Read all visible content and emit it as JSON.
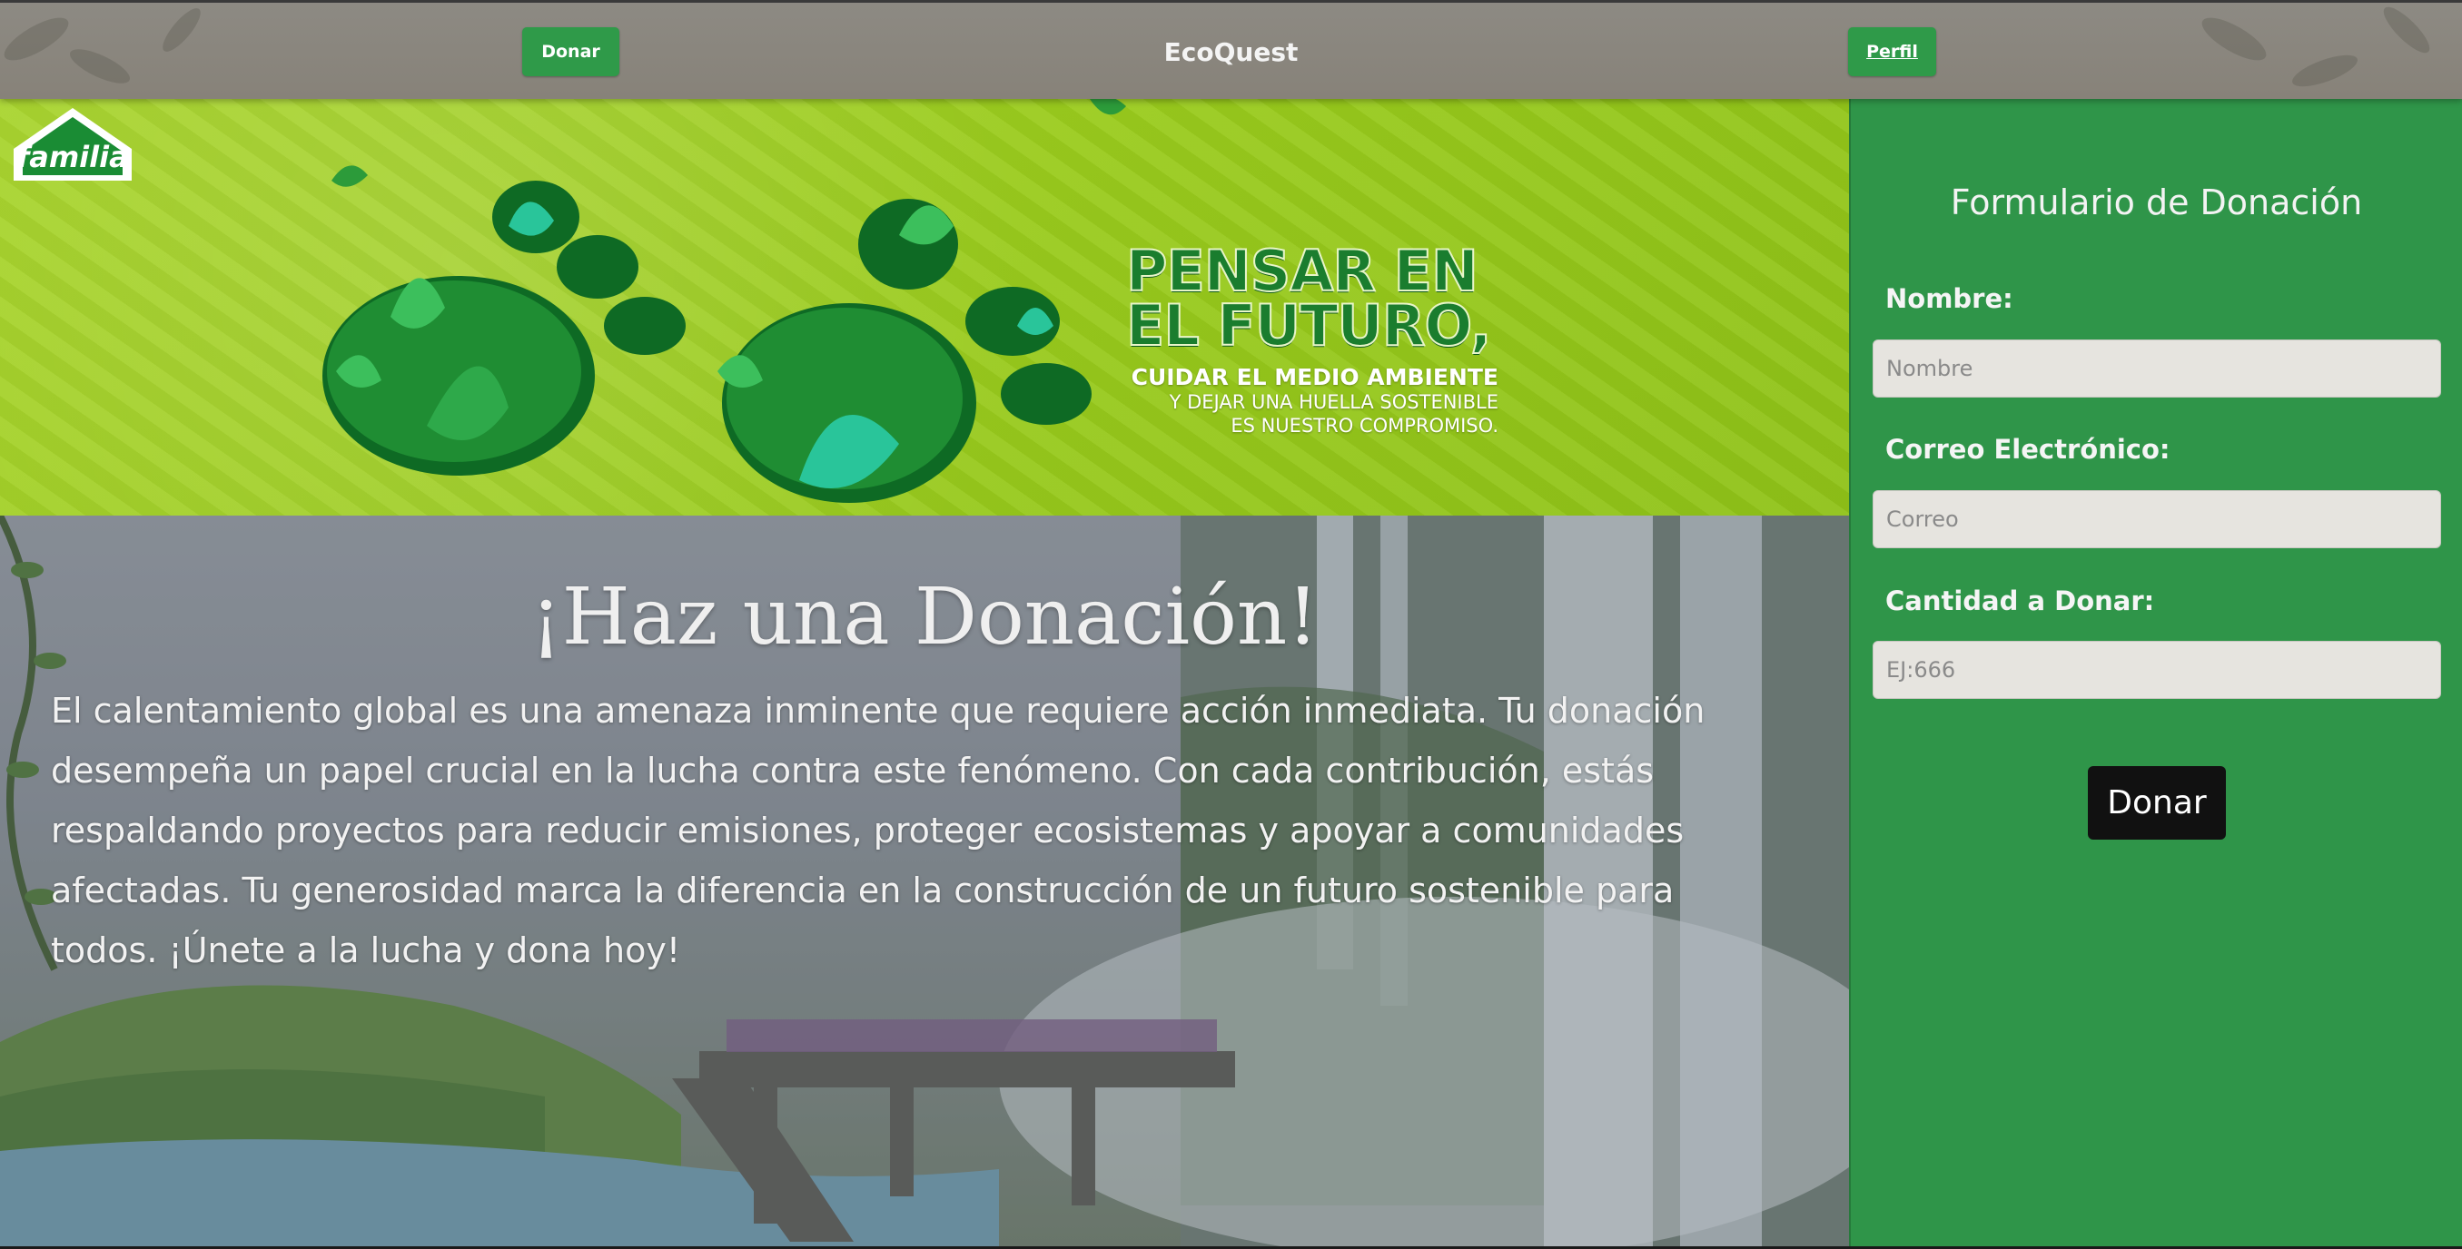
{
  "header": {
    "brand": "EcoQuest",
    "donate_label": "Donar",
    "profile_label": "Perfil"
  },
  "banner": {
    "logo_text": "familia",
    "headline_line1": "PENSAR EN",
    "headline_line2": "EL FUTURO,",
    "subline1": "CUIDAR EL MEDIO AMBIENTE",
    "subline2": "Y DEJAR UNA HUELLA SOSTENIBLE",
    "subline3": "ES NUESTRO COMPROMISO."
  },
  "hero": {
    "title": "¡Haz una Donación!",
    "body": "El calentamiento global es una amenaza inminente que requiere acción inmediata. Tu donación desempeña un papel crucial en la lucha contra este fenómeno. Con cada contribución, estás respaldando proyectos para reducir emisiones, proteger ecosistemas y apoyar a comunidades afectadas. Tu generosidad marca la diferencia en la construcción de un futuro sostenible para todos. ¡Únete a la lucha y dona hoy!"
  },
  "form": {
    "title": "Formulario de Donación",
    "name_label": "Nombre:",
    "name_placeholder": "Nombre",
    "email_label": "Correo Electrónico:",
    "email_placeholder": "Correo",
    "amount_label": "Cantidad a Donar:",
    "amount_placeholder": "EJ:666",
    "submit_label": "Donar"
  },
  "colors": {
    "accent_green": "#2f9a49",
    "panel_green": "#2f9549",
    "banner_lime": "#9acb1d",
    "topbar_gray": "#8a867f"
  }
}
